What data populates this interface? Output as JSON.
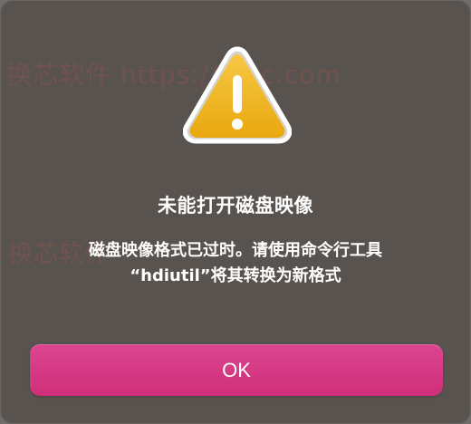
{
  "watermark": {
    "text": "换芯软件 https://mac.com",
    "text2": "换芯软件"
  },
  "dialog": {
    "icon": "warning-icon",
    "title": "未能打开磁盘映像",
    "message_line_1": "磁盘映像格式已过时。请使用命令行工具",
    "message_line_2": "“hdiutil”将其转换为新格式",
    "ok_label": "OK"
  },
  "colors": {
    "dialog_background": "#59534f",
    "button": "#d93b84",
    "warning_yellow": "#f0b51f",
    "text": "#ffffff"
  }
}
